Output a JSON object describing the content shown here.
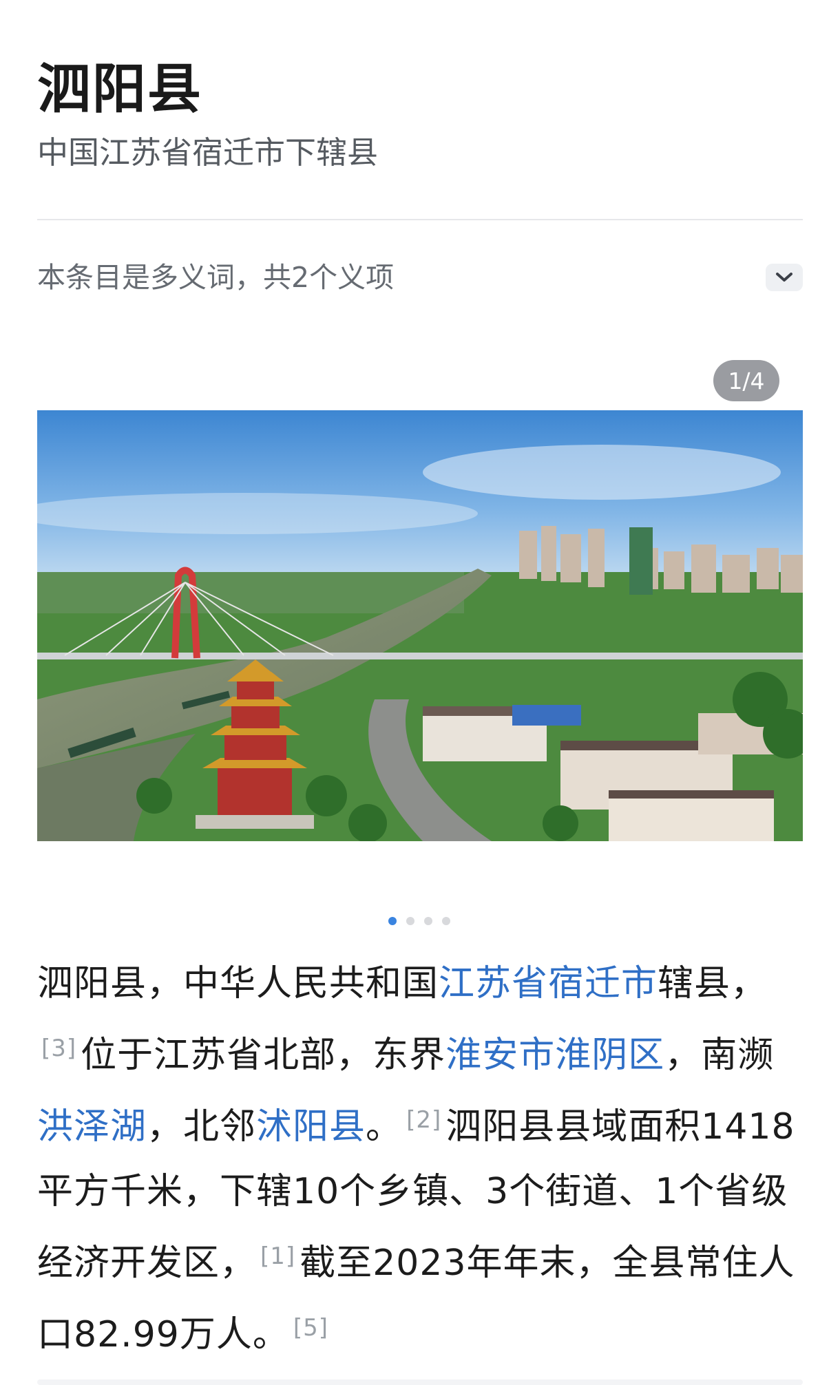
{
  "header": {
    "title": "泗阳县",
    "subtitle": "中国江苏省宿迁市下辖县"
  },
  "polysemy": {
    "text": "本条目是多义词，共2个义项",
    "toggle_icon": "chevron-down-icon"
  },
  "gallery": {
    "counter": "1/4",
    "total": 4,
    "active_index": 0,
    "image_description_icon": "aerial-photo"
  },
  "article": {
    "p1": "泗阳县，中华人民共和国",
    "link1": "江苏省宿迁市",
    "p2": "辖县，",
    "ref3": "[3]",
    "p3": "位于江苏省北部，东界",
    "link2": "淮安市淮阴区",
    "p4": "，南濒",
    "link3": "洪泽湖",
    "p5": "，北邻",
    "link4": "沭阳县",
    "p6": "。",
    "ref2": "[2]",
    "p7": "泗阳县县域面积1418平方千米，下辖10个乡镇、3个街道、1个省级经济开发区，",
    "ref1": "[1]",
    "p8": "截至2023年年末，全县常住人口82.99万人。",
    "ref5": "[5]"
  },
  "colors": {
    "link": "#2f6fc6",
    "active_dot": "#3a84e0",
    "counter_bg": "#9a9ca1"
  }
}
